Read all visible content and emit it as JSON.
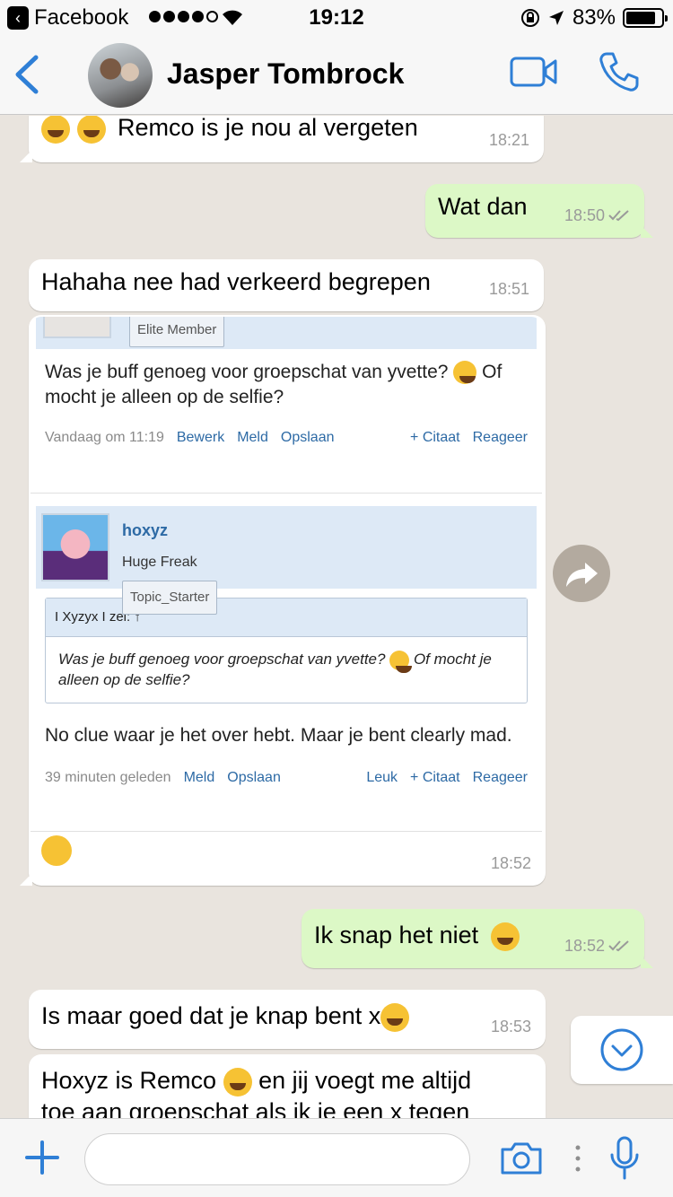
{
  "status_bar": {
    "carrier": "Facebook",
    "time": "19:12",
    "battery": "83%",
    "battery_level": 0.83
  },
  "header": {
    "contact_name": "Jasper Tombrock"
  },
  "messages": [
    {
      "side": "in",
      "text": "Remco is je nou al vergeten",
      "time": "18:21"
    },
    {
      "side": "out",
      "text": "Wat dan",
      "time": "18:50"
    },
    {
      "side": "in",
      "text": "Hahaha nee had verkeerd begrepen",
      "time": "18:51"
    },
    {
      "side": "out",
      "text": "Ik snap het niet",
      "time": "18:52"
    },
    {
      "side": "in",
      "text": "Is maar goed dat je knap bent x",
      "time": "18:53"
    },
    {
      "side": "in",
      "text": "Hoxyz is Remco",
      "text_2": "en jij voegt me altijd",
      "text_3": "toe aan groepschat als ik je een x tegen"
    }
  ],
  "forum_screenshot": {
    "time": "18:52",
    "first_post": {
      "tag": "Elite Member",
      "text": "Was je buff genoeg voor groepschat van yvette?",
      "text_after": "Of mocht je alleen op de selfie?",
      "date": "Vandaag om 11:19",
      "actions": [
        "Bewerk",
        "Meld",
        "Opslaan"
      ],
      "actions_right": [
        "+ Citaat",
        "Reageer"
      ]
    },
    "second_post": {
      "username": "hoxyz",
      "rank": "Huge Freak",
      "tag": "Topic_Starter",
      "quote_header": "I Xyzyx I zei: ↑",
      "quote_text": "Was je buff genoeg voor groepschat van yvette?",
      "quote_text_after": "Of mocht je alleen op de selfie?",
      "reply": "No clue waar je het over hebt. Maar je bent clearly mad.",
      "date": "39 minuten geleden",
      "actions": [
        "Meld",
        "Opslaan"
      ],
      "actions_right": [
        "Leuk",
        "+ Citaat",
        "Reageer"
      ]
    }
  },
  "icons": {
    "back": "chevron-left-icon",
    "video": "video-camera-icon",
    "call": "phone-icon",
    "share": "forward-icon",
    "scroll": "chevron-down-icon",
    "attach": "plus-icon",
    "camera": "camera-icon",
    "mic": "microphone-icon"
  },
  "colors": {
    "accent": "#2f7fd6",
    "outgoing_bubble": "#dcf8c6",
    "incoming_bubble": "#ffffff",
    "read_ticks": "#9a9a9a"
  }
}
